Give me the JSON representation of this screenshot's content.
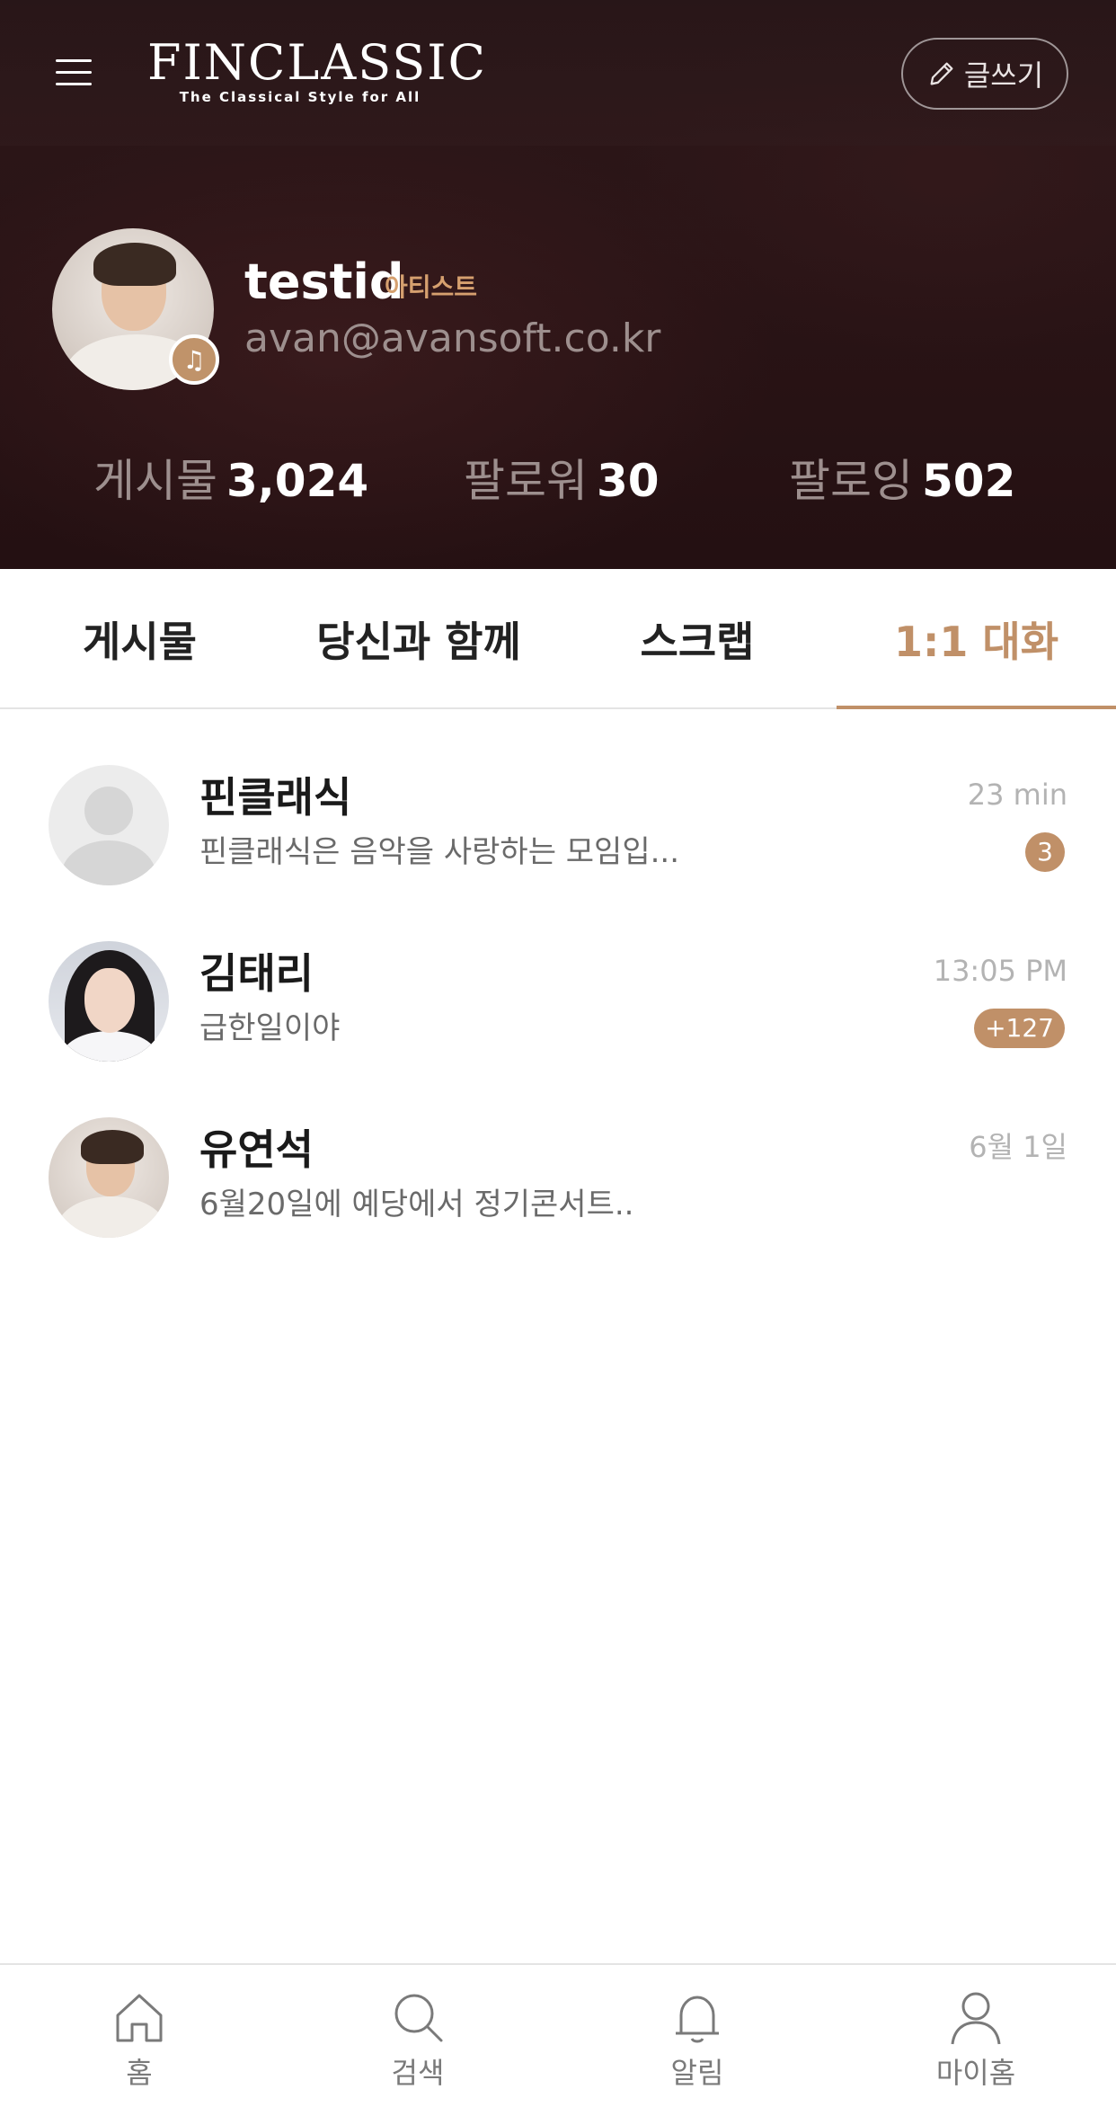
{
  "header": {
    "logo_title": "FINCLASSIC",
    "logo_subtitle": "The Classical Style for All",
    "write_label": "글쓰기"
  },
  "profile": {
    "name": "testid",
    "role": "아티스트",
    "email": "avan@avansoft.co.kr"
  },
  "stats": [
    {
      "label": "게시물",
      "value": "3,024"
    },
    {
      "label": "팔로워",
      "value": "30"
    },
    {
      "label": "팔로잉",
      "value": "502"
    }
  ],
  "tabs": [
    {
      "label": "게시물",
      "active": false
    },
    {
      "label": "당신과 함께",
      "active": false
    },
    {
      "label": "스크랩",
      "active": false
    },
    {
      "label": "1:1 대화",
      "active": true
    }
  ],
  "chats": [
    {
      "name": "핀클래식",
      "preview": "핀클래식은 음악을 사랑하는 모임입...",
      "time": "23 min",
      "badge": "3",
      "avatar": "default-avatar-icon"
    },
    {
      "name": "김태리",
      "preview": "급한일이야",
      "time": "13:05 PM",
      "badge": "+127",
      "avatar": "photo"
    },
    {
      "name": "유연석",
      "preview": "6월20일에 예당에서 정기콘서트..",
      "time": "6월 1일",
      "badge": "",
      "avatar": "photo"
    }
  ],
  "bottom_nav": [
    {
      "label": "홈",
      "icon": "home-icon"
    },
    {
      "label": "검색",
      "icon": "search-icon"
    },
    {
      "label": "알림",
      "icon": "bell-icon"
    },
    {
      "label": "마이홈",
      "icon": "user-icon"
    }
  ],
  "colors": {
    "accent": "#c09068",
    "hero_bg": "#2a1416",
    "role": "#d6a06f"
  }
}
